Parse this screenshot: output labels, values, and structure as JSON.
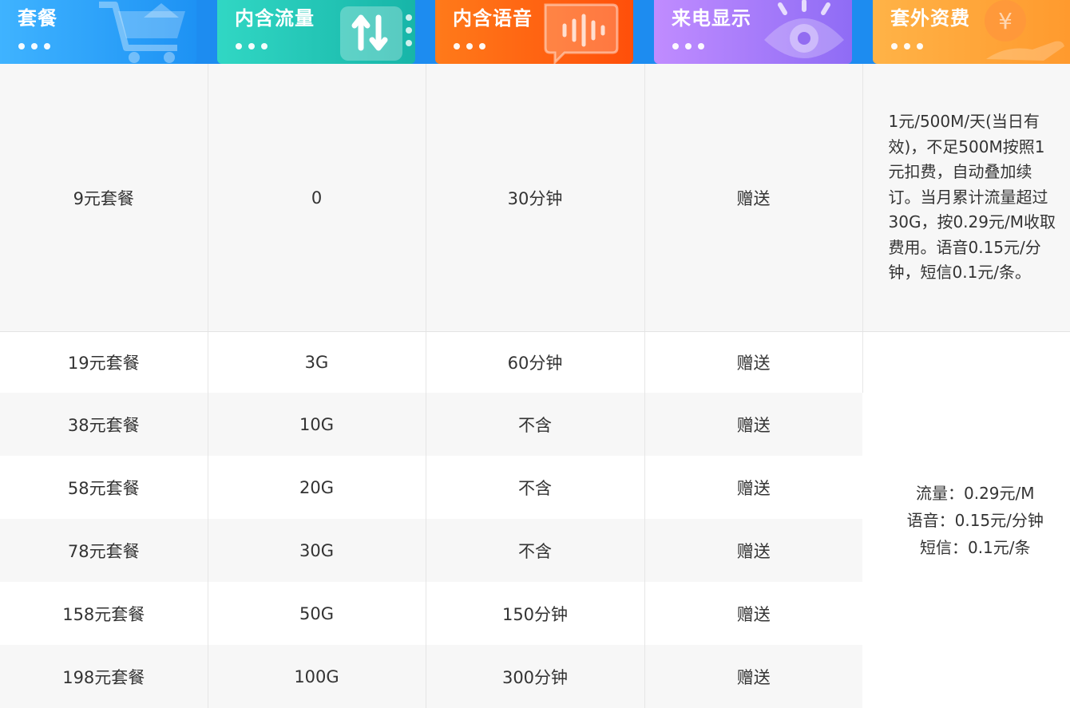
{
  "headers": [
    {
      "label": "套餐",
      "icon": "shopping-cart-icon"
    },
    {
      "label": "内含流量",
      "icon": "data-transfer-icon"
    },
    {
      "label": "内含语音",
      "icon": "voice-message-icon"
    },
    {
      "label": "来电显示",
      "icon": "eye-icon"
    },
    {
      "label": "套外资费",
      "icon": "yuan-coin-icon"
    }
  ],
  "rows": [
    {
      "plan": "9元套餐",
      "data": "0",
      "voice": "30分钟",
      "caller_id": "赠送"
    },
    {
      "plan": "19元套餐",
      "data": "3G",
      "voice": "60分钟",
      "caller_id": "赠送"
    },
    {
      "plan": "38元套餐",
      "data": "10G",
      "voice": "不含",
      "caller_id": "赠送"
    },
    {
      "plan": "58元套餐",
      "data": "20G",
      "voice": "不含",
      "caller_id": "赠送"
    },
    {
      "plan": "78元套餐",
      "data": "30G",
      "voice": "不含",
      "caller_id": "赠送"
    },
    {
      "plan": "158元套餐",
      "data": "50G",
      "voice": "150分钟",
      "caller_id": "赠送"
    },
    {
      "plan": "198元套餐",
      "data": "100G",
      "voice": "300分钟",
      "caller_id": "赠送"
    }
  ],
  "extra_fee_note_9": "1元/500M/天(当日有效)，不足500M按照1元扣费，自动叠加续订。当月累计流量超过30G，按0.29元/M收取费用。语音0.15元/分钟，短信0.1元/条。",
  "extra_fee_lines": [
    "流量：0.29元/M",
    "语音：0.15元/分钟",
    "短信：0.1元/条"
  ],
  "colors": {
    "header_plan": "#2a9ff8",
    "header_data": "#22c4b3",
    "header_voice": "#ff5f10",
    "header_caller_id": "#a47cfa",
    "header_fee": "#ffa63a",
    "top_strip": "#1d8cf0"
  }
}
